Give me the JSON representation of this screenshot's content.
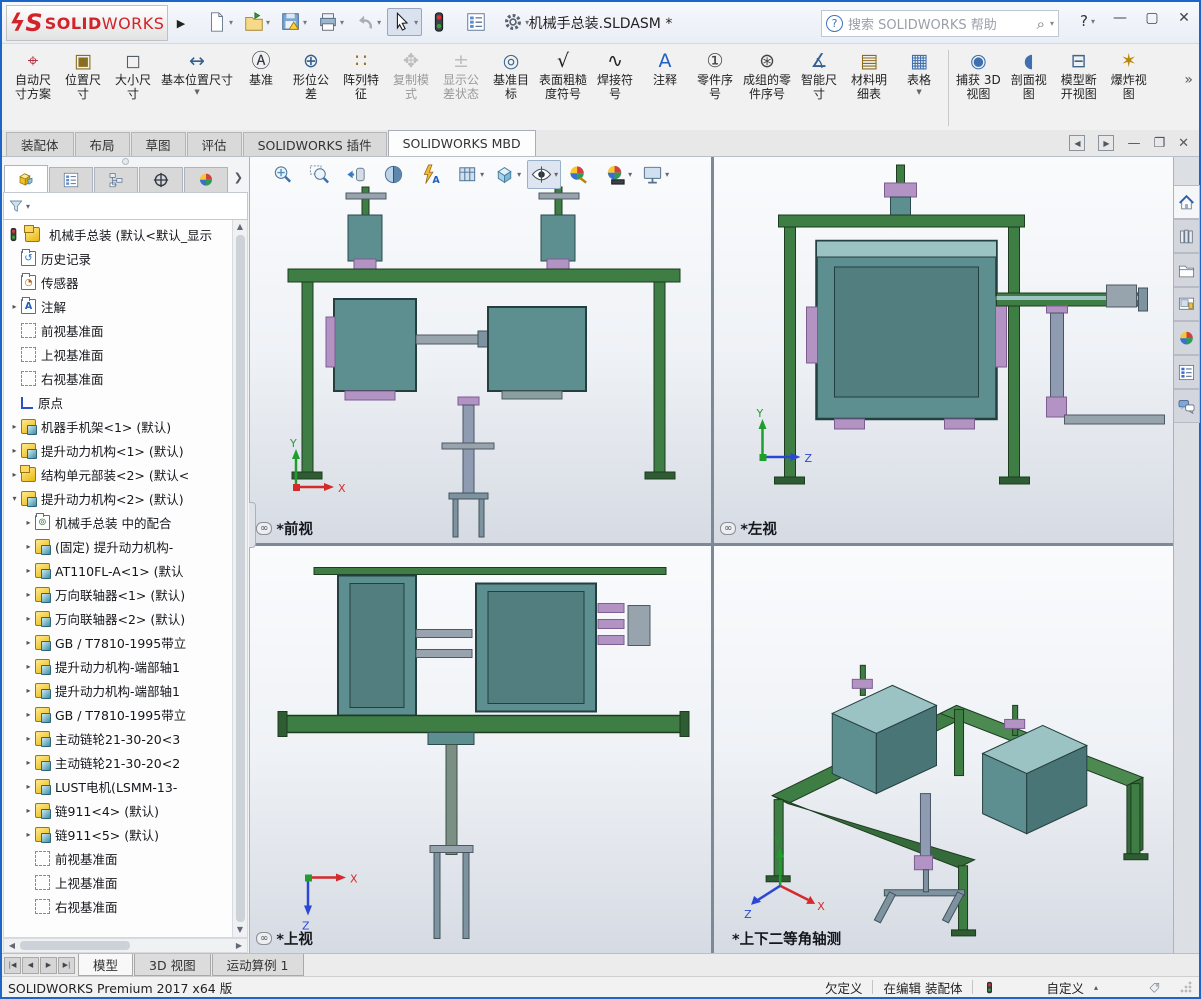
{
  "window": {
    "title": "机械手总装.SLDASM *",
    "brand_bold": "SOLID",
    "brand_light": "WORKS",
    "search_placeholder": "搜索 SOLIDWORKS 帮助",
    "help_label": "?"
  },
  "quick_toolbar": [
    {
      "name": "new-document-button",
      "sym": "new-document",
      "dropdown": true
    },
    {
      "name": "open-button",
      "sym": "open-document",
      "dropdown": true
    },
    {
      "name": "save-button",
      "sym": "save",
      "dropdown": true
    },
    {
      "name": "print-button",
      "sym": "print",
      "dropdown": true
    },
    {
      "name": "undo-button",
      "sym": "undo",
      "dropdown": true,
      "disabled": true
    },
    {
      "name": "select-button",
      "sym": "select-cursor",
      "dropdown": true,
      "boxed": true
    },
    {
      "name": "performance-button",
      "sym": "performance"
    },
    {
      "name": "command-list-button",
      "sym": "command-list"
    },
    {
      "name": "options-button",
      "sym": "options-gear",
      "dropdown": true
    }
  ],
  "ribbon": {
    "buttons": [
      {
        "name": "auto-dimension-scheme-button",
        "label": "自动尺\n寸方案",
        "glyph": "⌖",
        "color": "#b4323c"
      },
      {
        "name": "location-dimension-button",
        "label": "位置尺\n寸",
        "glyph": "▣",
        "color": "#8a6d1f"
      },
      {
        "name": "size-dimension-button",
        "label": "大小尺\n寸",
        "glyph": "◻",
        "color": "#555d66"
      },
      {
        "name": "basic-location-dimension-button",
        "label": "基本位置尺寸",
        "glyph": "↔",
        "color": "#335f8f",
        "dropdown": true,
        "wide": true
      },
      {
        "name": "datum-button",
        "label": "基准",
        "glyph": "Ⓐ",
        "color": "#333a44"
      },
      {
        "name": "geometric-tolerance-button",
        "label": "形位公\n差",
        "glyph": "⊕",
        "color": "#335f8f"
      },
      {
        "name": "pattern-feature-button",
        "label": "阵列特\n征",
        "glyph": "∷",
        "color": "#9a6f1f"
      },
      {
        "name": "copy-mode-button",
        "label": "复制模\n式",
        "glyph": "✥",
        "color": "#777",
        "disabled": true
      },
      {
        "name": "tolerance-status-button",
        "label": "显示公\n差状态",
        "glyph": "±",
        "color": "#777",
        "disabled": true
      },
      {
        "name": "datum-target-button",
        "label": "基准目\n标",
        "glyph": "◎",
        "color": "#40658c"
      },
      {
        "name": "surface-finish-button",
        "label": "表面粗糙\n度符号",
        "glyph": "√",
        "color": "#222"
      },
      {
        "name": "weld-symbol-button",
        "label": "焊接符\n号",
        "glyph": "∿",
        "color": "#222"
      },
      {
        "name": "note-button",
        "label": "注释",
        "glyph": "A",
        "color": "#1f5fbf"
      },
      {
        "name": "balloon-button",
        "label": "零件序\n号",
        "glyph": "①",
        "color": "#444"
      },
      {
        "name": "stacked-balloon-button",
        "label": "成组的零\n件序号",
        "glyph": "⊛",
        "color": "#444"
      },
      {
        "name": "smart-dimension-button",
        "label": "智能尺\n寸",
        "glyph": "∡",
        "color": "#335f8f"
      },
      {
        "name": "bill-of-materials-button",
        "label": "材料明\n细表",
        "glyph": "▤",
        "color": "#8a6d1f"
      },
      {
        "name": "tables-button",
        "label": "表格",
        "glyph": "▦",
        "color": "#3f6fae",
        "dropdown": true
      },
      {
        "sep": true
      },
      {
        "name": "capture-3d-view-button",
        "label": "捕获 3D\n视图",
        "glyph": "◉",
        "color": "#3f6fae"
      },
      {
        "name": "section-view-button",
        "label": "剖面视\n图",
        "glyph": "◖",
        "color": "#3f6fae"
      },
      {
        "name": "model-break-view-button",
        "label": "模型断\n开视图",
        "glyph": "⊟",
        "color": "#40658c"
      },
      {
        "name": "exploded-view-button",
        "label": "爆炸视\n图",
        "glyph": "✶",
        "color": "#b8860b"
      }
    ],
    "overflow": "»"
  },
  "command_tabs": [
    {
      "name": "tab-assembly",
      "label": "装配体"
    },
    {
      "name": "tab-layout",
      "label": "布局"
    },
    {
      "name": "tab-sketch",
      "label": "草图"
    },
    {
      "name": "tab-evaluate",
      "label": "评估"
    },
    {
      "name": "tab-solidworks-addins",
      "label": "SOLIDWORKS 插件"
    },
    {
      "name": "tab-solidworks-mbd",
      "label": "SOLIDWORKS MBD",
      "active": true
    }
  ],
  "fm_tabs": [
    {
      "name": "featuremanager-design-tree-tab",
      "sym": "fm-asm",
      "active": true
    },
    {
      "name": "propertymanager-tab",
      "sym": "command-list"
    },
    {
      "name": "configurationmanager-tab",
      "sym": "config"
    },
    {
      "name": "dimxpertmanager-tab",
      "sym": "target"
    },
    {
      "name": "displaymanager-tab",
      "sym": "appearances"
    }
  ],
  "feature_tree": {
    "root_label": "机械手总装 (默认<默认_显示",
    "items": [
      {
        "icon": "hist",
        "label": "历史记录",
        "indent": 1
      },
      {
        "icon": "sensor",
        "label": "传感器",
        "indent": 1
      },
      {
        "icon": "ann",
        "label": "注解",
        "indent": 1,
        "arrow": "r"
      },
      {
        "icon": "plane",
        "label": "前视基准面",
        "indent": 1
      },
      {
        "icon": "plane",
        "label": "上视基准面",
        "indent": 1
      },
      {
        "icon": "plane",
        "label": "右视基准面",
        "indent": 1
      },
      {
        "icon": "origin",
        "label": "原点",
        "indent": 1
      },
      {
        "icon": "part",
        "label": "机器手机架<1> (默认)",
        "indent": 1,
        "arrow": "r"
      },
      {
        "icon": "part",
        "label": "提升动力机构<1> (默认)",
        "indent": 1,
        "arrow": "r"
      },
      {
        "icon": "asm",
        "label": "结构单元部装<2> (默认<",
        "indent": 1,
        "arrow": "r"
      },
      {
        "icon": "part",
        "label": "提升动力机构<2> (默认)",
        "indent": 1,
        "arrow": "d"
      },
      {
        "icon": "mates",
        "label": "机械手总装 中的配合",
        "indent": 2,
        "arrow": "r"
      },
      {
        "icon": "part",
        "label": "(固定) 提升动力机构-",
        "indent": 2,
        "arrow": "r"
      },
      {
        "icon": "part",
        "label": "AT110FL-A<1> (默认",
        "indent": 2,
        "arrow": "r"
      },
      {
        "icon": "part",
        "label": "万向联轴器<1> (默认)",
        "indent": 2,
        "arrow": "r"
      },
      {
        "icon": "part",
        "label": "万向联轴器<2> (默认)",
        "indent": 2,
        "arrow": "r"
      },
      {
        "icon": "part",
        "label": "GB / T7810-1995带立",
        "indent": 2,
        "arrow": "r"
      },
      {
        "icon": "part",
        "label": "提升动力机构-端部轴1",
        "indent": 2,
        "arrow": "r"
      },
      {
        "icon": "part",
        "label": "提升动力机构-端部轴1",
        "indent": 2,
        "arrow": "r"
      },
      {
        "icon": "part",
        "label": "GB / T7810-1995带立",
        "indent": 2,
        "arrow": "r"
      },
      {
        "icon": "part",
        "label": "主动链轮21-30-20<3",
        "indent": 2,
        "arrow": "r"
      },
      {
        "icon": "part",
        "label": "主动链轮21-30-20<2",
        "indent": 2,
        "arrow": "r"
      },
      {
        "icon": "part",
        "label": "LUST电机(LSMM-13-",
        "indent": 2,
        "arrow": "r"
      },
      {
        "icon": "part",
        "label": "链911<4> (默认)",
        "indent": 2,
        "arrow": "r"
      },
      {
        "icon": "part",
        "label": "链911<5> (默认)",
        "indent": 2,
        "arrow": "r"
      },
      {
        "icon": "plane",
        "label": "前视基准面",
        "indent": 2
      },
      {
        "icon": "plane",
        "label": "上视基准面",
        "indent": 2
      },
      {
        "icon": "plane",
        "label": "右视基准面",
        "indent": 2
      }
    ]
  },
  "headsup": [
    {
      "name": "zoom-to-fit-button",
      "sym": "zoom-to-fit"
    },
    {
      "name": "zoom-to-area-button",
      "sym": "zoom-to-area"
    },
    {
      "name": "previous-view-button",
      "sym": "previous-view"
    },
    {
      "name": "section-view-hud-button",
      "sym": "section-view"
    },
    {
      "name": "dynamic-annotation-views-button",
      "sym": "annotation-views"
    },
    {
      "name": "display-style-button",
      "sym": "display-style",
      "dropdown": true
    },
    {
      "name": "view-orientation-button",
      "sym": "view-cube",
      "dropdown": true
    },
    {
      "name": "hide-show-items-button",
      "sym": "eye",
      "dropdown": true,
      "pressed": true
    },
    {
      "name": "edit-appearance-button",
      "sym": "edit-appearance"
    },
    {
      "name": "apply-scene-button",
      "sym": "apply-scene",
      "dropdown": true
    },
    {
      "name": "view-settings-button",
      "sym": "view-settings",
      "dropdown": true
    }
  ],
  "viewports": [
    {
      "label": "*前视",
      "linked": true
    },
    {
      "label": "*左视",
      "linked": true
    },
    {
      "label": "*上视",
      "linked": true
    },
    {
      "label": "*上下二等角轴测",
      "linked": false
    }
  ],
  "task_pane": [
    {
      "name": "task-pane-home-tab",
      "sym": "home",
      "active": true
    },
    {
      "name": "design-library-tab",
      "sym": "design-library"
    },
    {
      "name": "file-explorer-tab",
      "sym": "file-explorer"
    },
    {
      "name": "view-palette-tab",
      "sym": "view-palette"
    },
    {
      "name": "appearances-tab",
      "sym": "appearances"
    },
    {
      "name": "custom-properties-tab",
      "sym": "custom-properties"
    },
    {
      "name": "forum-tab",
      "sym": "forum"
    }
  ],
  "doc_tabs": [
    {
      "name": "model-tab",
      "label": "模型",
      "active": true
    },
    {
      "name": "3d-views-tab",
      "label": "3D 视图"
    },
    {
      "name": "motion-study-tab",
      "label": "运动算例 1"
    }
  ],
  "status_bar": {
    "product": "SOLIDWORKS Premium 2017 x64 版",
    "definition_state": "欠定义",
    "editing_state": "在编辑 装配体",
    "custom_label": "自定义"
  }
}
